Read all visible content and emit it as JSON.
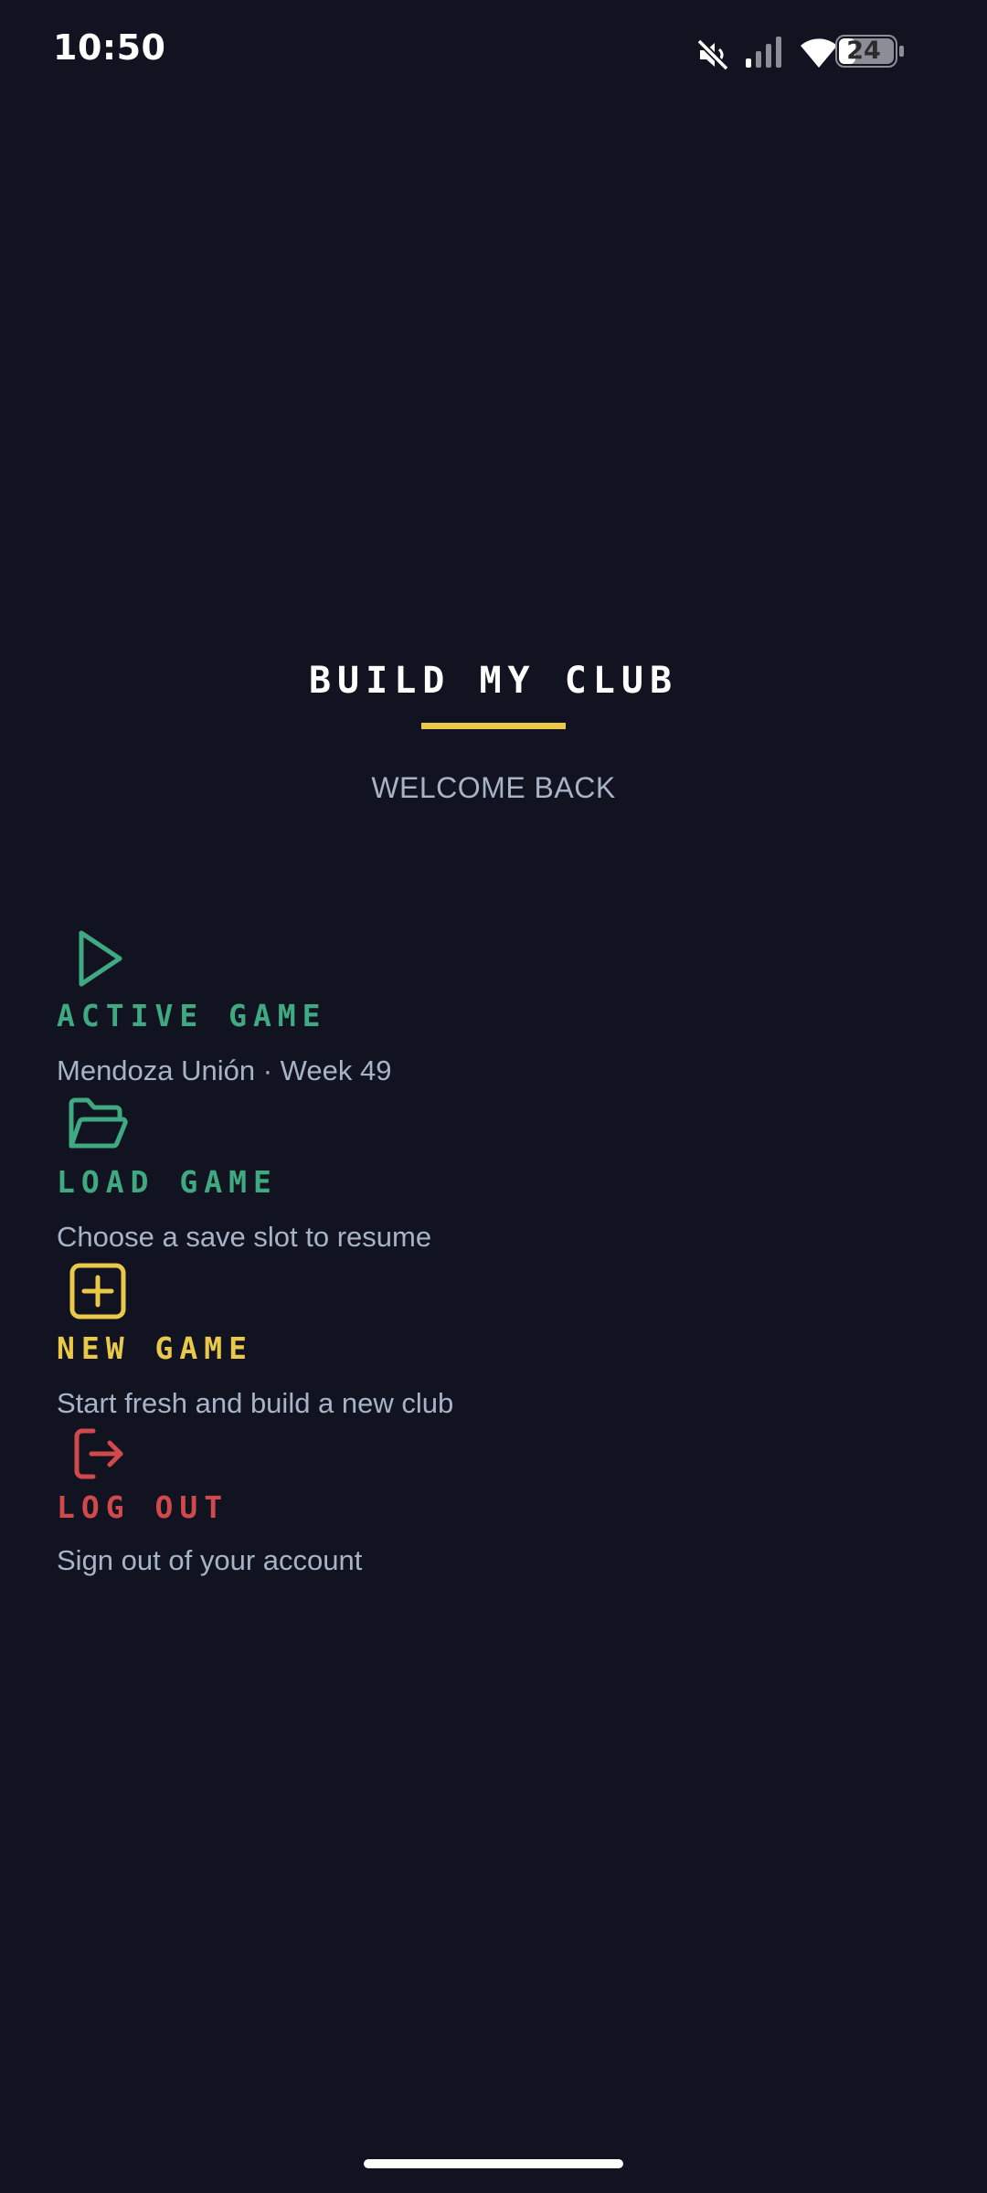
{
  "status_bar": {
    "time": "10:50",
    "battery_level": "24",
    "icons": [
      "mute-icon",
      "cellular-signal-icon",
      "wifi-icon",
      "battery-icon"
    ]
  },
  "header": {
    "title": "BUILD MY CLUB",
    "subtitle": "WELCOME BACK",
    "accent_color": "#e9c84a"
  },
  "menu": {
    "active_game": {
      "icon": "play-icon",
      "label": "ACTIVE GAME",
      "description": "Mendoza Unión · Week 49",
      "color": "#3fa982"
    },
    "load_game": {
      "icon": "folder-open-icon",
      "label": "LOAD GAME",
      "description": "Choose a save slot to resume",
      "color": "#3fa982"
    },
    "new_game": {
      "icon": "plus-square-icon",
      "label": "NEW GAME",
      "description": "Start fresh and build a new club",
      "color": "#e9c84a"
    },
    "log_out": {
      "icon": "log-out-icon",
      "label": "LOG OUT",
      "description": "Sign out of your account",
      "color": "#d2494c"
    }
  },
  "colors": {
    "background": "#111420",
    "text_muted": "#a7b3c6"
  }
}
